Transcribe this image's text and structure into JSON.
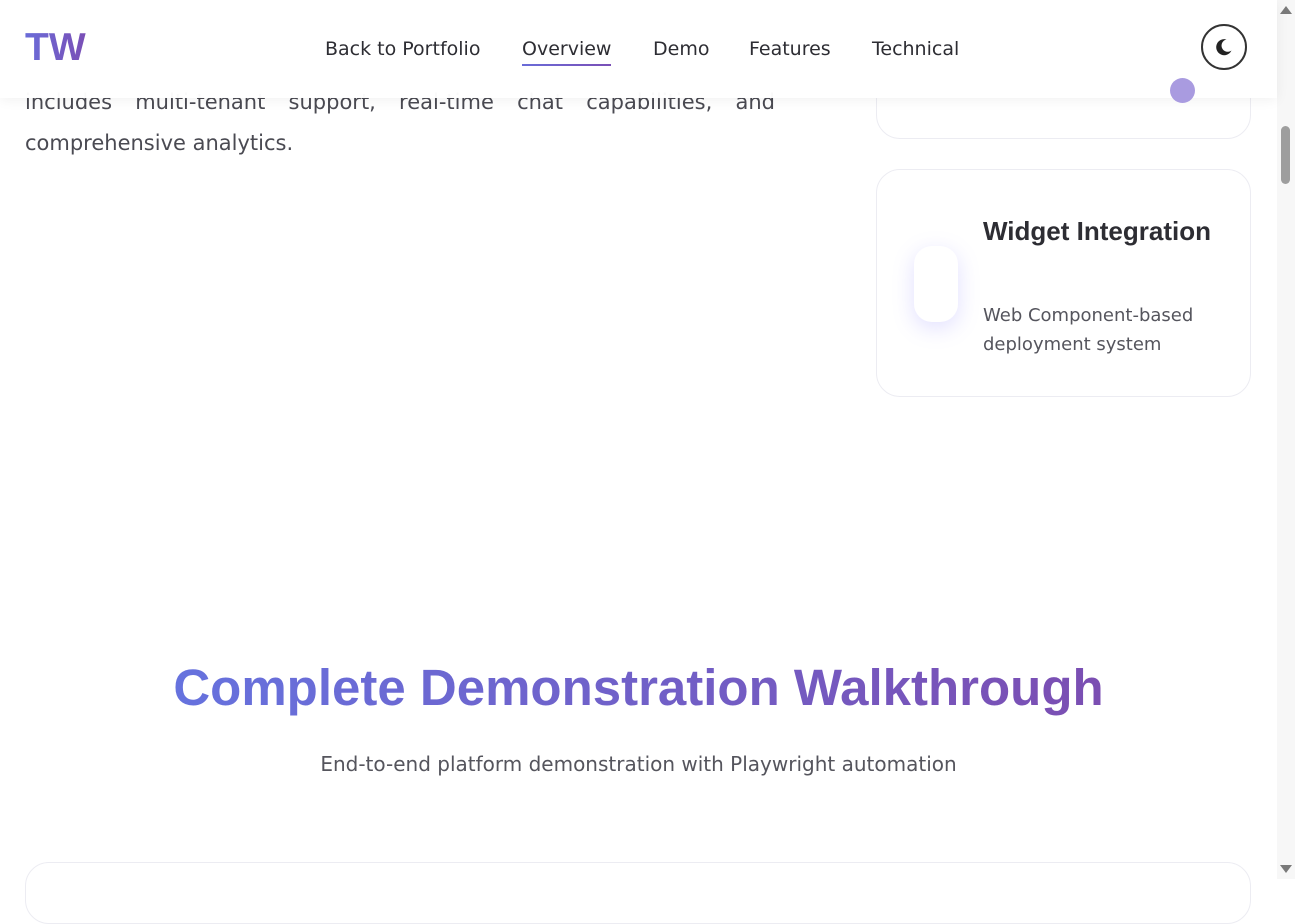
{
  "header": {
    "logo": "TW",
    "nav": [
      {
        "label": "Back to Portfolio",
        "active": false
      },
      {
        "label": "Overview",
        "active": true
      },
      {
        "label": "Demo",
        "active": false
      },
      {
        "label": "Features",
        "active": false
      },
      {
        "label": "Technical",
        "active": false
      }
    ],
    "theme_toggle_icon": "moon-icon"
  },
  "intro": {
    "text": "includes multi-tenant support, real-time chat capabilities, and comprehensive analytics."
  },
  "features": [
    {
      "title": "Widget Integration",
      "description": "Web Component-based deployment system"
    }
  ],
  "demo_section": {
    "title": "Complete Demonstration Walkthrough",
    "subtitle": "End-to-end platform demonstration with Playwright automation"
  },
  "colors": {
    "accent_start": "#6a6cd8",
    "accent_end": "#7a4fb6"
  }
}
